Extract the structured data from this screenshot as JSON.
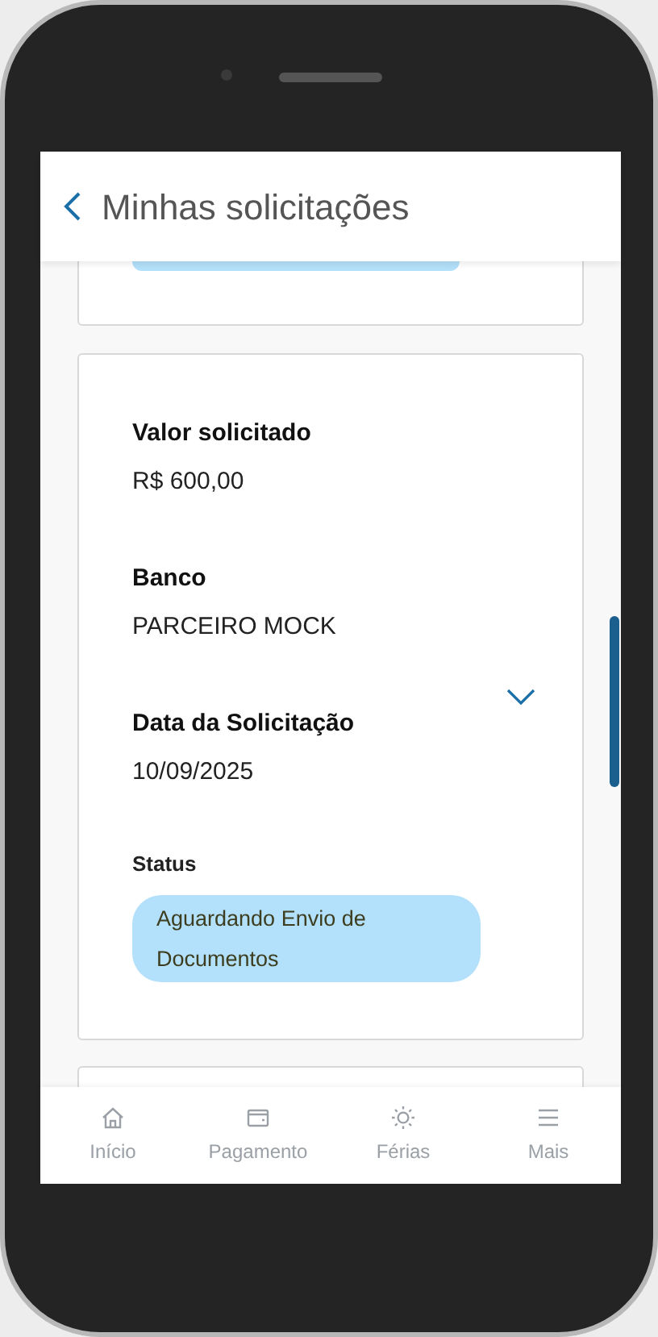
{
  "header": {
    "title": "Minhas solicitações"
  },
  "request": {
    "fields": [
      {
        "label": "Valor solicitado",
        "value": "R$ 600,00"
      },
      {
        "label": "Banco",
        "value": "PARCEIRO MOCK"
      },
      {
        "label": "Data da Solicitação",
        "value": "10/09/2025"
      }
    ],
    "expanded": false,
    "status_label": "Status",
    "status": "Aguardando Envio de Documentos"
  },
  "nav": [
    {
      "kind": "home",
      "label": "Início"
    },
    {
      "kind": "wallet",
      "label": "Pagamento"
    },
    {
      "kind": "sun",
      "label": "Férias"
    },
    {
      "kind": "menu",
      "label": "Mais"
    }
  ]
}
